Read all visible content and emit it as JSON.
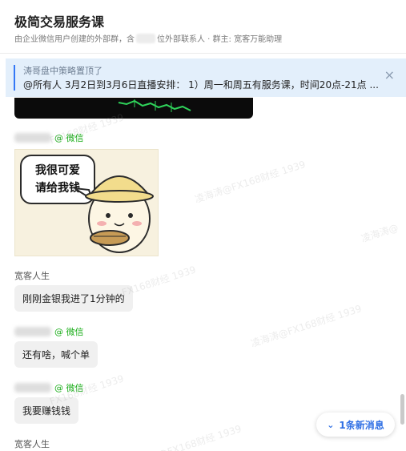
{
  "header": {
    "title": "极简交易服务课",
    "subtitle_part1": "由企业微信用户创建的外部群，含",
    "subtitle_part2": "位外部联系人 · 群主: 宽客万能助理"
  },
  "pinned": {
    "title": "涛哥盘中策略置顶了",
    "text": "@所有人 3月2日到3月6日直播安排： 1）周一和周五有服务课，时间20点-21点 ...",
    "close_icon": "×"
  },
  "messages": {
    "wechat_tag": "@ 微信",
    "sticker_line1": "我很可爱",
    "sticker_line2": "请给我钱",
    "sender_kuanke": "宽客人生",
    "msg1": "刚刚金银我进了1分钟的",
    "msg2": "还有啥，喊个单",
    "msg3": "我要赚钱钱",
    "sender_kuanke_bottom": "宽客人生"
  },
  "new_message": {
    "icon": "chevron-down-icon",
    "label": "1条新消息"
  },
  "watermarks": {
    "w1": "FX168财经 1939",
    "w2": "凌海涛@FX168财经 1939",
    "w3": "凌海涛@"
  },
  "colors": {
    "accent": "#3478f6",
    "pinned_bg": "#e3effb",
    "wechat_green": "#1aad19",
    "bubble_bg": "#f0f0f0"
  }
}
